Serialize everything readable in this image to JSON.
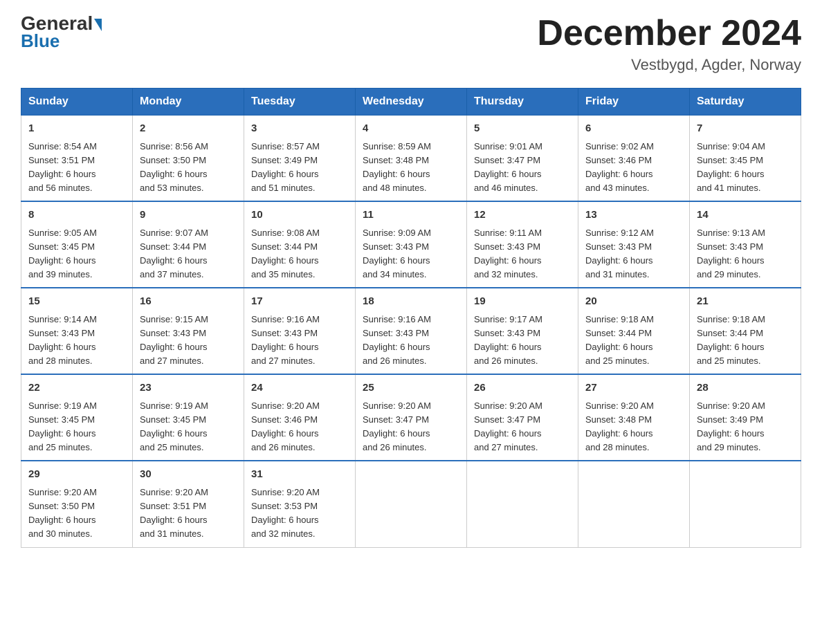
{
  "header": {
    "logo_general": "General",
    "logo_blue": "Blue",
    "month_title": "December 2024",
    "location": "Vestbygd, Agder, Norway"
  },
  "days_of_week": [
    "Sunday",
    "Monday",
    "Tuesday",
    "Wednesday",
    "Thursday",
    "Friday",
    "Saturday"
  ],
  "weeks": [
    [
      {
        "day": "1",
        "info": "Sunrise: 8:54 AM\nSunset: 3:51 PM\nDaylight: 6 hours\nand 56 minutes."
      },
      {
        "day": "2",
        "info": "Sunrise: 8:56 AM\nSunset: 3:50 PM\nDaylight: 6 hours\nand 53 minutes."
      },
      {
        "day": "3",
        "info": "Sunrise: 8:57 AM\nSunset: 3:49 PM\nDaylight: 6 hours\nand 51 minutes."
      },
      {
        "day": "4",
        "info": "Sunrise: 8:59 AM\nSunset: 3:48 PM\nDaylight: 6 hours\nand 48 minutes."
      },
      {
        "day": "5",
        "info": "Sunrise: 9:01 AM\nSunset: 3:47 PM\nDaylight: 6 hours\nand 46 minutes."
      },
      {
        "day": "6",
        "info": "Sunrise: 9:02 AM\nSunset: 3:46 PM\nDaylight: 6 hours\nand 43 minutes."
      },
      {
        "day": "7",
        "info": "Sunrise: 9:04 AM\nSunset: 3:45 PM\nDaylight: 6 hours\nand 41 minutes."
      }
    ],
    [
      {
        "day": "8",
        "info": "Sunrise: 9:05 AM\nSunset: 3:45 PM\nDaylight: 6 hours\nand 39 minutes."
      },
      {
        "day": "9",
        "info": "Sunrise: 9:07 AM\nSunset: 3:44 PM\nDaylight: 6 hours\nand 37 minutes."
      },
      {
        "day": "10",
        "info": "Sunrise: 9:08 AM\nSunset: 3:44 PM\nDaylight: 6 hours\nand 35 minutes."
      },
      {
        "day": "11",
        "info": "Sunrise: 9:09 AM\nSunset: 3:43 PM\nDaylight: 6 hours\nand 34 minutes."
      },
      {
        "day": "12",
        "info": "Sunrise: 9:11 AM\nSunset: 3:43 PM\nDaylight: 6 hours\nand 32 minutes."
      },
      {
        "day": "13",
        "info": "Sunrise: 9:12 AM\nSunset: 3:43 PM\nDaylight: 6 hours\nand 31 minutes."
      },
      {
        "day": "14",
        "info": "Sunrise: 9:13 AM\nSunset: 3:43 PM\nDaylight: 6 hours\nand 29 minutes."
      }
    ],
    [
      {
        "day": "15",
        "info": "Sunrise: 9:14 AM\nSunset: 3:43 PM\nDaylight: 6 hours\nand 28 minutes."
      },
      {
        "day": "16",
        "info": "Sunrise: 9:15 AM\nSunset: 3:43 PM\nDaylight: 6 hours\nand 27 minutes."
      },
      {
        "day": "17",
        "info": "Sunrise: 9:16 AM\nSunset: 3:43 PM\nDaylight: 6 hours\nand 27 minutes."
      },
      {
        "day": "18",
        "info": "Sunrise: 9:16 AM\nSunset: 3:43 PM\nDaylight: 6 hours\nand 26 minutes."
      },
      {
        "day": "19",
        "info": "Sunrise: 9:17 AM\nSunset: 3:43 PM\nDaylight: 6 hours\nand 26 minutes."
      },
      {
        "day": "20",
        "info": "Sunrise: 9:18 AM\nSunset: 3:44 PM\nDaylight: 6 hours\nand 25 minutes."
      },
      {
        "day": "21",
        "info": "Sunrise: 9:18 AM\nSunset: 3:44 PM\nDaylight: 6 hours\nand 25 minutes."
      }
    ],
    [
      {
        "day": "22",
        "info": "Sunrise: 9:19 AM\nSunset: 3:45 PM\nDaylight: 6 hours\nand 25 minutes."
      },
      {
        "day": "23",
        "info": "Sunrise: 9:19 AM\nSunset: 3:45 PM\nDaylight: 6 hours\nand 25 minutes."
      },
      {
        "day": "24",
        "info": "Sunrise: 9:20 AM\nSunset: 3:46 PM\nDaylight: 6 hours\nand 26 minutes."
      },
      {
        "day": "25",
        "info": "Sunrise: 9:20 AM\nSunset: 3:47 PM\nDaylight: 6 hours\nand 26 minutes."
      },
      {
        "day": "26",
        "info": "Sunrise: 9:20 AM\nSunset: 3:47 PM\nDaylight: 6 hours\nand 27 minutes."
      },
      {
        "day": "27",
        "info": "Sunrise: 9:20 AM\nSunset: 3:48 PM\nDaylight: 6 hours\nand 28 minutes."
      },
      {
        "day": "28",
        "info": "Sunrise: 9:20 AM\nSunset: 3:49 PM\nDaylight: 6 hours\nand 29 minutes."
      }
    ],
    [
      {
        "day": "29",
        "info": "Sunrise: 9:20 AM\nSunset: 3:50 PM\nDaylight: 6 hours\nand 30 minutes."
      },
      {
        "day": "30",
        "info": "Sunrise: 9:20 AM\nSunset: 3:51 PM\nDaylight: 6 hours\nand 31 minutes."
      },
      {
        "day": "31",
        "info": "Sunrise: 9:20 AM\nSunset: 3:53 PM\nDaylight: 6 hours\nand 32 minutes."
      },
      null,
      null,
      null,
      null
    ]
  ]
}
